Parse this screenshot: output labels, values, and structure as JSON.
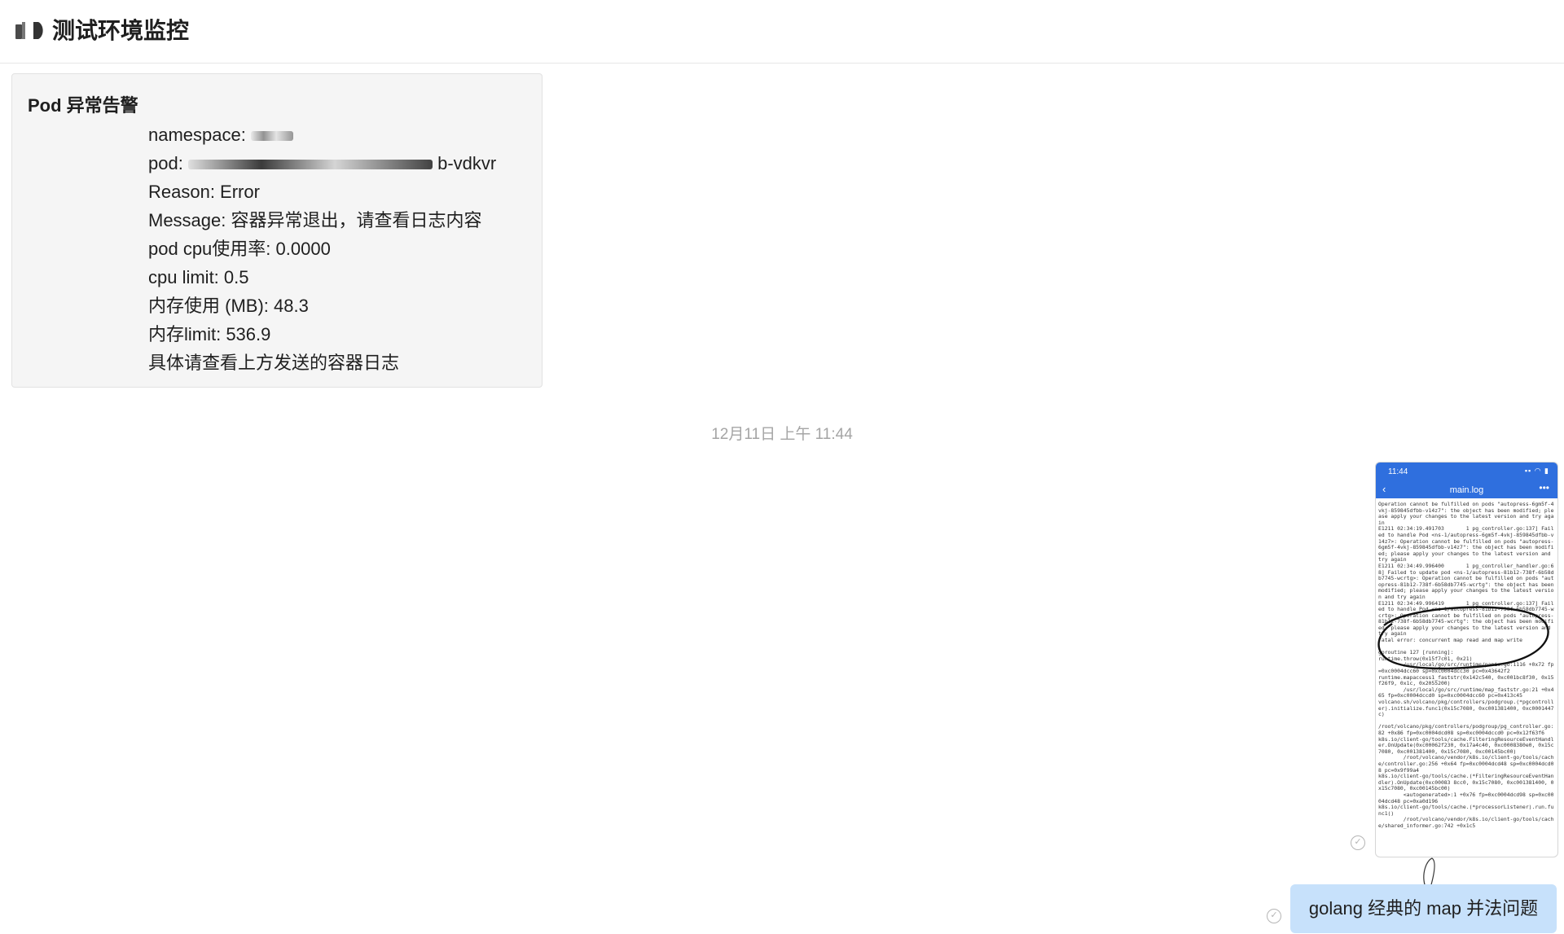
{
  "header": {
    "title": "测试环境监控",
    "icon": "notebook-icon"
  },
  "card": {
    "title": "Pod 异常告警",
    "lines": {
      "namespace": "namespace:",
      "pod_prefix": "pod:",
      "pod_suffix": "b-vdkvr",
      "reason": "Reason: Error",
      "message": "Message: 容器异常退出，请查看日志内容",
      "cpu_usage": "pod cpu使用率: 0.0000",
      "cpu_limit": "cpu limit: 0.5",
      "mem_usage": "内存使用 (MB): 48.3",
      "mem_limit": "内存limit: 536.9",
      "footer": "具体请查看上方发送的容器日志"
    }
  },
  "timestamp": "12月11日 上午 11:44",
  "screenshot": {
    "time": "11:44",
    "filename": "main.log",
    "log_text": "Operation cannot be fulfilled on pods \"autopress-6gm5f-4vkj-859845dfbb-v14z7\": the object has been modified; please apply your changes to the latest version and try again\nE1211 02:34:19.491703       1 pg_controller.go:137] Failed to handle Pod <ns-1/autopress-6gm5f-4vkj-859845dfbb-v14z7>: Operation cannot be fulfilled on pods \"autopress-6gm5f-4vkj-859845dfbb-v14z7\": the object has been modified; please apply your changes to the latest version and try again\nE1211 02:34:49.996400       1 pg_controller_handler.go:68] Failed to update pod <ns-1/autopress-81b12-738f-6b58db7745-wcrtg>: Operation cannot be fulfilled on pods \"autopress-81b12-738f-6b58db7745-wcrtg\": the object has been modified; please apply your changes to the latest version and try again\nE1211 02:34:49.996419       1 pg_controller.go:137] Failed to handle Pod <ns-1/autopress-81b12-738f-6b58db7745-wcrtg>: Operation cannot be fulfilled on pods \"autopress-81b12-738f-6b58db7745-wcrtg\": the object has been modified; please apply your changes to the latest version and try again\nfatal error: concurrent map read and map write\n\ngoroutine 127 [running]:\nruntime.throw(0x15f7c01, 0x21)\n        /usr/local/go/src/runtime/panic.go:1116 +0x72 fp=0xc0004dcc60 sp=0xc0004dcc30 pc=0x43642f2\nruntime.mapaccess1_faststr(0x142c540, 0xc001bc8f30, 0x15f26f9, 0x1c, 0x2055200)\n        /usr/local/go/src/runtime/map_faststr.go:21 +0x465 fp=0xc0004dccd0 sp=0xc0004dcc60 pc=0x413c45\nvolcano.sh/volcano/pkg/controllers/podgroup.(*pgcontroller).initialize.func1(0x15c7080, 0xc001381400, 0xc0001447c)\n\n/root/volcano/pkg/controllers/podgroup/pg_controller.go:82 +0x86 fp=0xc0004dcd08 sp=0xc0004dccd0 pc=0x12f63f6\nk8s.io/client-go/tools/cache.FilteringResourceEventHandler.OnUpdate(0xc00062f230, 0x17a4c40, 0xc0008380e0, 0x15c7080, 0xc001381400, 0x15c7080, 0xc00145bc00)\n        /root/volcano/vendor/k8s.io/client-go/tools/cache/controller.go:256 +0x64 fp=0xc0004dcd48 sp=0xc0004dcd08 pc=0x9f99a4\nk8s.io/client-go/tools/cache.(*FilteringResourceEventHandler).OnUpdate(0xc00083 8cc0, 0x15c7080, 0xc001381400, 0x15c7080, 0xc00145bc00)\n        <autogenerated>:1 +0x76 fp=0xc0004dcd98 sp=0xc0004dcd48 pc=0xa0d196\nk8s.io/client-go/tools/cache.(*processorListener).run.func1()\n        /root/volcano/vendor/k8s.io/client-go/tools/cache/shared_informer.go:742 +0x1c5"
  },
  "message": {
    "text": "golang 经典的 map 并法问题"
  },
  "icons": {
    "read_receipt": "read-check-icon"
  },
  "colors": {
    "bubble": "#c7e1fb",
    "app_bar": "#2f6fde",
    "card_bg": "#f5f5f5"
  }
}
